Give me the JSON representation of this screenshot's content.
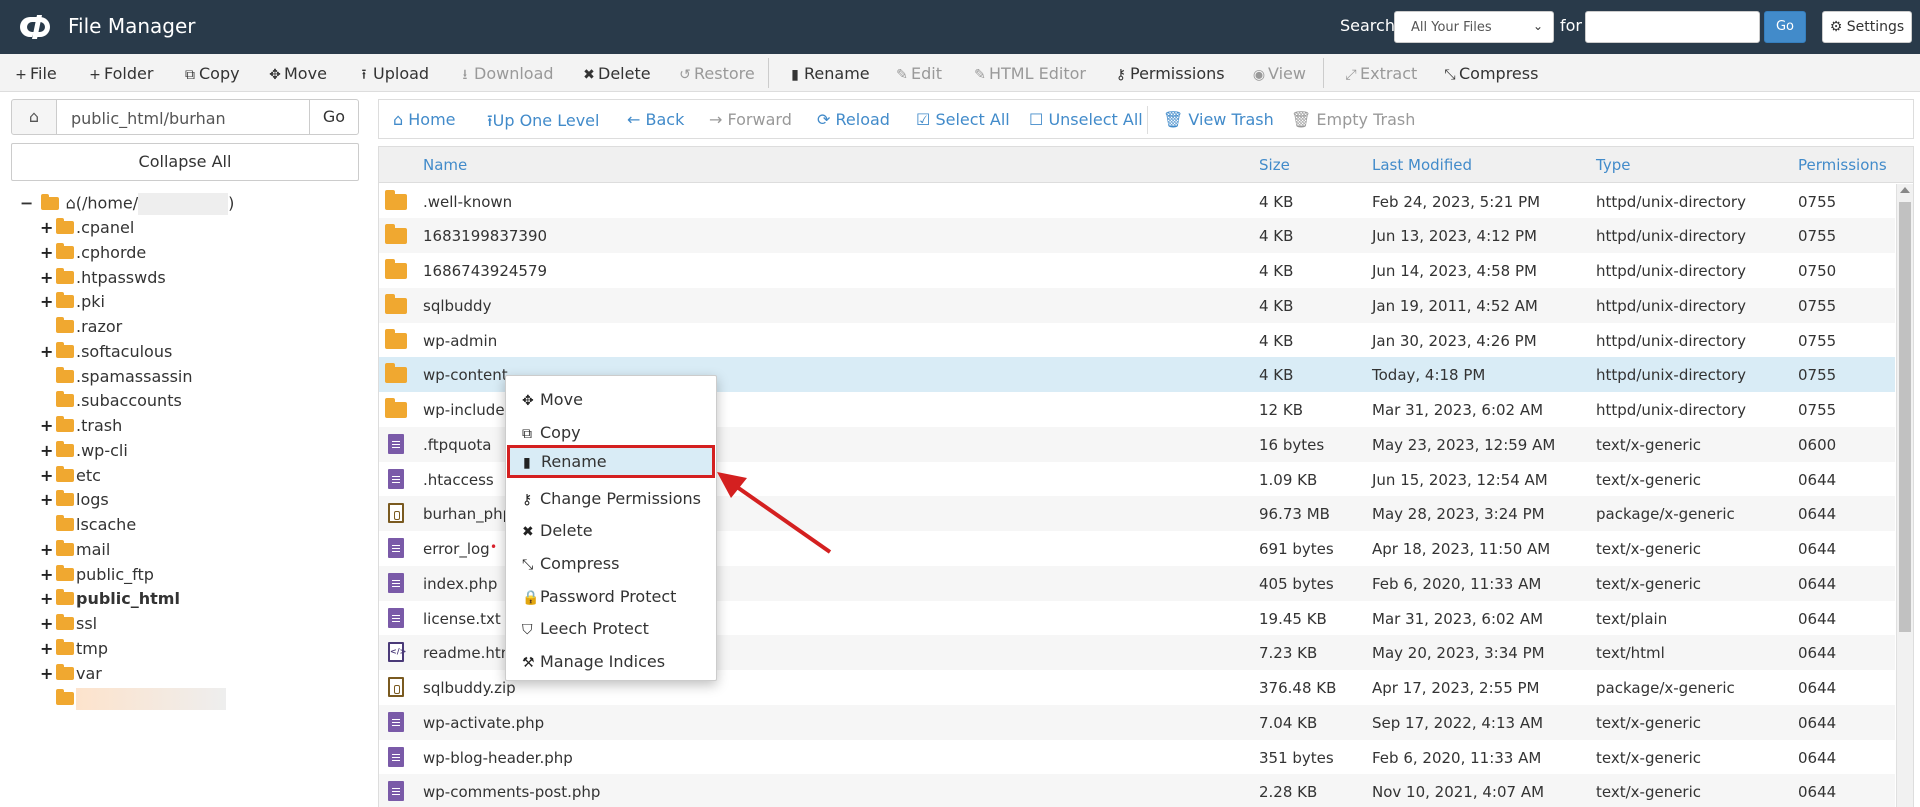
{
  "header": {
    "app_title": "File Manager",
    "search_label": "Search",
    "search_scope": "All Your Files",
    "for_label": "for",
    "search_value": "",
    "go_label": "Go",
    "settings_label": "Settings"
  },
  "toolbar": {
    "items": [
      {
        "label": "File",
        "icon": "plus-icon",
        "glyph": "+"
      },
      {
        "label": "Folder",
        "icon": "plus-icon",
        "glyph": "+"
      },
      {
        "label": "Copy",
        "icon": "copy-icon",
        "glyph": "⧉"
      },
      {
        "label": "Move",
        "icon": "move-icon",
        "glyph": "✥"
      },
      {
        "label": "Upload",
        "icon": "upload-icon",
        "glyph": "⭱"
      },
      {
        "label": "Download",
        "icon": "download-icon",
        "glyph": "⭳"
      },
      {
        "label": "Delete",
        "icon": "close-icon",
        "glyph": "✖"
      },
      {
        "label": "Restore",
        "icon": "restore-icon",
        "glyph": "↺"
      },
      {
        "label": "Rename",
        "icon": "file-icon",
        "glyph": "▮"
      },
      {
        "label": "Edit",
        "icon": "pencil-icon",
        "glyph": "✎"
      },
      {
        "label": "HTML Editor",
        "icon": "edit-icon",
        "glyph": "✎"
      },
      {
        "label": "Permissions",
        "icon": "key-icon",
        "glyph": "⚷"
      },
      {
        "label": "View",
        "icon": "eye-icon",
        "glyph": "◉"
      },
      {
        "label": "Extract",
        "icon": "expand-icon",
        "glyph": "⤢"
      },
      {
        "label": "Compress",
        "icon": "compress-icon",
        "glyph": "⤡"
      }
    ]
  },
  "left": {
    "path_value": "public_html/burhan",
    "go_label": "Go",
    "collapse_label": "Collapse All",
    "root_label": "(/home/",
    "root_close": ")",
    "tree": [
      {
        "label": ".cpanel",
        "expand": "+"
      },
      {
        "label": ".cphorde",
        "expand": "+"
      },
      {
        "label": ".htpasswds",
        "expand": "+"
      },
      {
        "label": ".pki",
        "expand": "+"
      },
      {
        "label": ".razor",
        "expand": ""
      },
      {
        "label": ".softaculous",
        "expand": "+"
      },
      {
        "label": ".spamassassin",
        "expand": ""
      },
      {
        "label": ".subaccounts",
        "expand": ""
      },
      {
        "label": ".trash",
        "expand": "+"
      },
      {
        "label": ".wp-cli",
        "expand": "+"
      },
      {
        "label": "etc",
        "expand": "+"
      },
      {
        "label": "logs",
        "expand": "+"
      },
      {
        "label": "lscache",
        "expand": ""
      },
      {
        "label": "mail",
        "expand": "+"
      },
      {
        "label": "public_ftp",
        "expand": "+"
      },
      {
        "label": "public_html",
        "expand": "+"
      },
      {
        "label": "ssl",
        "expand": "+"
      },
      {
        "label": "tmp",
        "expand": "+"
      },
      {
        "label": "var",
        "expand": "+"
      }
    ]
  },
  "nav": {
    "items": [
      {
        "label": "Home",
        "glyph": "⌂"
      },
      {
        "label": "Up One Level",
        "glyph": "⭱"
      },
      {
        "label": "Back",
        "glyph": "←"
      },
      {
        "label": "Forward",
        "glyph": "→"
      },
      {
        "label": "Reload",
        "glyph": "⟳"
      },
      {
        "label": "Select All",
        "glyph": "☑"
      },
      {
        "label": "Unselect All",
        "glyph": "☐"
      },
      {
        "label": "View Trash",
        "glyph": "🗑"
      },
      {
        "label": "Empty Trash",
        "glyph": "🗑"
      }
    ]
  },
  "table": {
    "columns": [
      "Name",
      "Size",
      "Last Modified",
      "Type",
      "Permissions"
    ],
    "rows": [
      {
        "name": ".well-known",
        "size": "4 KB",
        "modified": "Feb 24, 2023, 5:21 PM",
        "type": "httpd/unix-directory",
        "perms": "0755",
        "kind": "folder"
      },
      {
        "name": "1683199837390",
        "size": "4 KB",
        "modified": "Jun 13, 2023, 4:12 PM",
        "type": "httpd/unix-directory",
        "perms": "0755",
        "kind": "folder"
      },
      {
        "name": "1686743924579",
        "size": "4 KB",
        "modified": "Jun 14, 2023, 4:58 PM",
        "type": "httpd/unix-directory",
        "perms": "0750",
        "kind": "folder"
      },
      {
        "name": "sqlbuddy",
        "size": "4 KB",
        "modified": "Jan 19, 2011, 4:52 AM",
        "type": "httpd/unix-directory",
        "perms": "0755",
        "kind": "folder"
      },
      {
        "name": "wp-admin",
        "size": "4 KB",
        "modified": "Jan 30, 2023, 4:26 PM",
        "type": "httpd/unix-directory",
        "perms": "0755",
        "kind": "folder"
      },
      {
        "name": "wp-content",
        "size": "4 KB",
        "modified": "Today, 4:18 PM",
        "type": "httpd/unix-directory",
        "perms": "0755",
        "kind": "folder"
      },
      {
        "name": "wp-includes",
        "size": "12 KB",
        "modified": "Mar 31, 2023, 6:02 AM",
        "type": "httpd/unix-directory",
        "perms": "0755",
        "kind": "folder"
      },
      {
        "name": ".ftpquota",
        "size": "16 bytes",
        "modified": "May 23, 2023, 12:59 AM",
        "type": "text/x-generic",
        "perms": "0600",
        "kind": "doc"
      },
      {
        "name": ".htaccess",
        "size": "1.09 KB",
        "modified": "Jun 15, 2023, 12:54 AM",
        "type": "text/x-generic",
        "perms": "0644",
        "kind": "doc"
      },
      {
        "name": "burhan_php",
        "size": "96.73 MB",
        "modified": "May 28, 2023, 3:24 PM",
        "type": "package/x-generic",
        "perms": "0644",
        "kind": "zip"
      },
      {
        "name": "error_log",
        "size": "691 bytes",
        "modified": "Apr 18, 2023, 11:50 AM",
        "type": "text/x-generic",
        "perms": "0644",
        "kind": "doc"
      },
      {
        "name": "index.php",
        "size": "405 bytes",
        "modified": "Feb 6, 2020, 11:33 AM",
        "type": "text/x-generic",
        "perms": "0644",
        "kind": "doc"
      },
      {
        "name": "license.txt",
        "size": "19.45 KB",
        "modified": "Mar 31, 2023, 6:02 AM",
        "type": "text/plain",
        "perms": "0644",
        "kind": "doc"
      },
      {
        "name": "readme.html",
        "size": "7.23 KB",
        "modified": "May 20, 2023, 3:34 PM",
        "type": "text/html",
        "perms": "0644",
        "kind": "html"
      },
      {
        "name": "sqlbuddy.zip",
        "size": "376.48 KB",
        "modified": "Apr 17, 2023, 2:55 PM",
        "type": "package/x-generic",
        "perms": "0644",
        "kind": "zip"
      },
      {
        "name": "wp-activate.php",
        "size": "7.04 KB",
        "modified": "Sep 17, 2022, 4:13 AM",
        "type": "text/x-generic",
        "perms": "0644",
        "kind": "doc"
      },
      {
        "name": "wp-blog-header.php",
        "size": "351 bytes",
        "modified": "Feb 6, 2020, 11:33 AM",
        "type": "text/x-generic",
        "perms": "0644",
        "kind": "doc"
      },
      {
        "name": "wp-comments-post.php",
        "size": "2.28 KB",
        "modified": "Nov 10, 2021, 4:07 AM",
        "type": "text/x-generic",
        "perms": "0644",
        "kind": "doc"
      }
    ]
  },
  "context_menu": {
    "items": [
      {
        "label": "Move",
        "glyph": "✥",
        "icon": "move-icon"
      },
      {
        "label": "Copy",
        "glyph": "⧉",
        "icon": "copy-icon"
      },
      {
        "label": "Rename",
        "glyph": "▮",
        "icon": "file-icon"
      },
      {
        "label": "Change Permissions",
        "glyph": "⚷",
        "icon": "key-icon"
      },
      {
        "label": "Delete",
        "glyph": "✖",
        "icon": "close-icon"
      },
      {
        "label": "Compress",
        "glyph": "⤡",
        "icon": "compress-icon"
      },
      {
        "label": "Password Protect",
        "glyph": "🔒",
        "icon": "lock-icon"
      },
      {
        "label": "Leech Protect",
        "glyph": "⛉",
        "icon": "shield-icon"
      },
      {
        "label": "Manage Indices",
        "glyph": "⚒",
        "icon": "wrench-icon"
      }
    ]
  },
  "colors": {
    "header_bg": "#293a4a",
    "accent": "#428bca",
    "folder": "#f0a830",
    "selected_row": "#d9ecf6",
    "highlight_border": "#d42020"
  }
}
